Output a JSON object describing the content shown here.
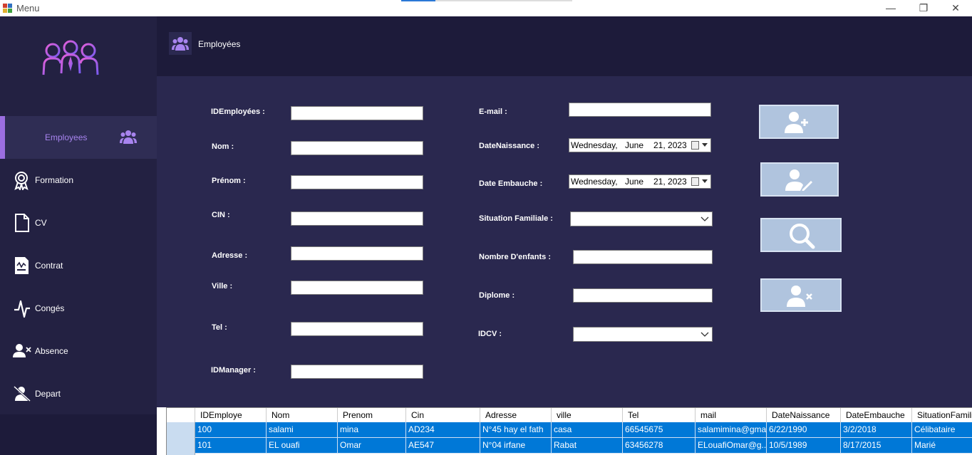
{
  "window": {
    "title": "Menu"
  },
  "sidebar": {
    "active": {
      "label": "Employees"
    },
    "items": [
      {
        "label": "Formation"
      },
      {
        "label": "CV"
      },
      {
        "label": "Contrat"
      },
      {
        "label": "Congés"
      },
      {
        "label": "Absence"
      },
      {
        "label": "Depart"
      }
    ]
  },
  "header": {
    "title": "Employées"
  },
  "form": {
    "left": [
      {
        "label": "IDEmployées :",
        "value": ""
      },
      {
        "label": "Nom :",
        "value": ""
      },
      {
        "label": "Prénom :",
        "value": ""
      },
      {
        "label": "CIN :",
        "value": ""
      },
      {
        "label": "Adresse :",
        "value": ""
      },
      {
        "label": "Ville :",
        "value": ""
      },
      {
        "label": "Tel :",
        "value": ""
      },
      {
        "label": "IDManager :",
        "value": ""
      }
    ],
    "email_label": "E-mail :",
    "birth_label": "DateNaissance :",
    "birth_date": {
      "weekday": "Wednesday,",
      "month": "June",
      "day_year": "21, 2023"
    },
    "hire_label": "Date Embauche :",
    "hire_date": {
      "weekday": "Wednesday,",
      "month": "June",
      "day_year": "21, 2023"
    },
    "situation_label": "Situation Familiale :",
    "children_label": "Nombre D'enfants :",
    "diploma_label": "Diplome :",
    "idcv_label": "IDCV :"
  },
  "actions": [
    "add-user-icon",
    "edit-user-icon",
    "search-icon",
    "delete-user-icon"
  ],
  "grid": {
    "columns": [
      "IDEmploye",
      "Nom",
      "Prenom",
      "Cin",
      "Adresse",
      "ville",
      "Tel",
      "mail",
      "DateNaissance",
      "DateEmbauche",
      "SituationFamiliale"
    ],
    "rows": [
      [
        "100",
        "salami",
        "mina",
        "AD234",
        "N°45 hay el fath",
        "casa",
        "66545675",
        "salamimina@gma...",
        "6/22/1990",
        "3/2/2018",
        "Célibataire"
      ],
      [
        "101",
        "EL ouafi",
        "Omar",
        "AE547",
        "N°04 irfane",
        "Rabat",
        "63456278",
        "ELouafiOmar@g...",
        "10/5/1989",
        "8/17/2015",
        "Marié"
      ]
    ]
  },
  "colors": {
    "sidebar": "#232142",
    "main": "#2a284f",
    "accent": "#9b6ee0",
    "button": "#b0c4de",
    "selection": "#0078d7"
  }
}
